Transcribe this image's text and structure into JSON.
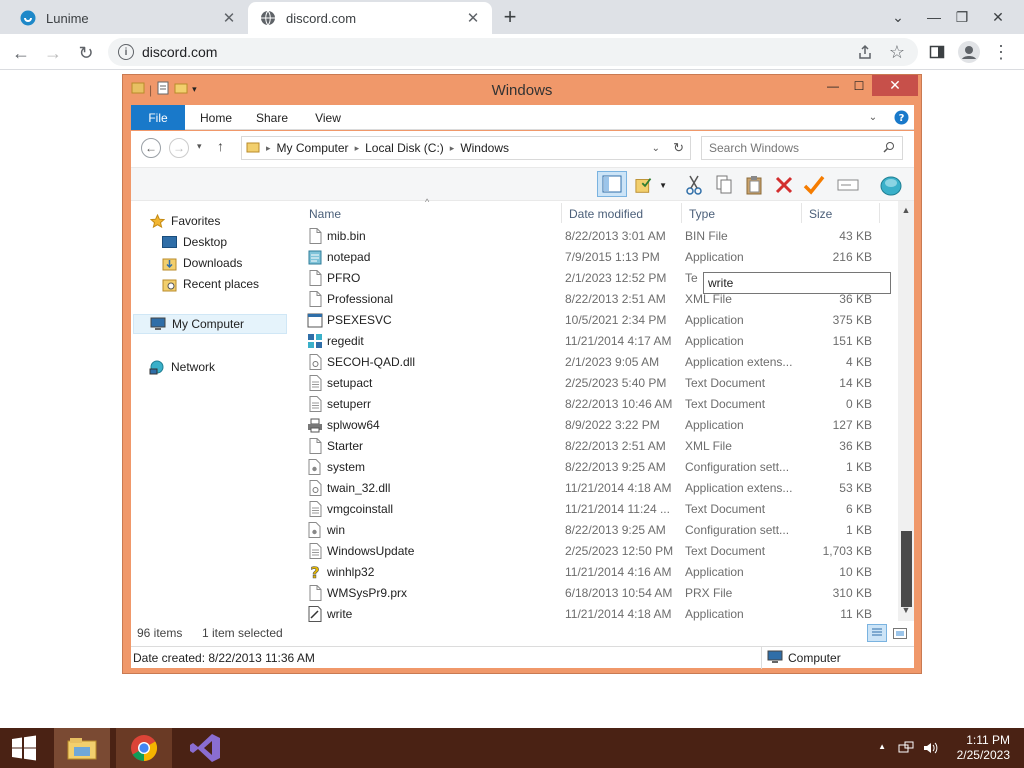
{
  "browser": {
    "tabs": [
      {
        "title": "Lunime",
        "favicon": "lunime-icon"
      },
      {
        "title": "discord.com",
        "favicon": "globe-icon"
      }
    ],
    "url": "discord.com"
  },
  "window": {
    "title": "Windows",
    "accent_color": "#f0986a"
  },
  "ribbon": {
    "tabs": [
      "File",
      "Home",
      "Share",
      "View"
    ]
  },
  "address": {
    "crumbs": [
      "My Computer",
      "Local Disk (C:)",
      "Windows"
    ],
    "search_placeholder": "Search Windows"
  },
  "nav": {
    "favorites": "Favorites",
    "desktop": "Desktop",
    "downloads": "Downloads",
    "recent": "Recent places",
    "computer": "My Computer",
    "network": "Network"
  },
  "columns": {
    "name": "Name",
    "date": "Date modified",
    "type": "Type",
    "size": "Size"
  },
  "files": [
    {
      "name": "mib.bin",
      "date": "8/22/2013 3:01 AM",
      "type": "BIN File",
      "size": "43 KB",
      "icon": "file-icon"
    },
    {
      "name": "notepad",
      "date": "7/9/2015 1:13 PM",
      "type": "Application",
      "size": "216 KB",
      "icon": "notepad-icon"
    },
    {
      "name": "PFRO",
      "date": "2/1/2023 12:52 PM",
      "type": "Te",
      "size": "",
      "icon": "file-icon"
    },
    {
      "name": "Professional",
      "date": "8/22/2013 2:51 AM",
      "type": "XML File",
      "size": "36 KB",
      "icon": "file-icon"
    },
    {
      "name": "PSEXESVC",
      "date": "10/5/2021 2:34 PM",
      "type": "Application",
      "size": "375 KB",
      "icon": "app-window-icon"
    },
    {
      "name": "regedit",
      "date": "11/21/2014 4:17 AM",
      "type": "Application",
      "size": "151 KB",
      "icon": "regedit-icon"
    },
    {
      "name": "SECOH-QAD.dll",
      "date": "2/1/2023 9:05 AM",
      "type": "Application extens...",
      "size": "4 KB",
      "icon": "dll-icon"
    },
    {
      "name": "setupact",
      "date": "2/25/2023 5:40 PM",
      "type": "Text Document",
      "size": "14 KB",
      "icon": "text-file-icon"
    },
    {
      "name": "setuperr",
      "date": "8/22/2013 10:46 AM",
      "type": "Text Document",
      "size": "0 KB",
      "icon": "text-file-icon"
    },
    {
      "name": "splwow64",
      "date": "8/9/2022 3:22 PM",
      "type": "Application",
      "size": "127 KB",
      "icon": "printer-icon"
    },
    {
      "name": "Starter",
      "date": "8/22/2013 2:51 AM",
      "type": "XML File",
      "size": "36 KB",
      "icon": "file-icon"
    },
    {
      "name": "system",
      "date": "8/22/2013 9:25 AM",
      "type": "Configuration sett...",
      "size": "1 KB",
      "icon": "settings-file-icon"
    },
    {
      "name": "twain_32.dll",
      "date": "11/21/2014 4:18 AM",
      "type": "Application extens...",
      "size": "53 KB",
      "icon": "dll-icon"
    },
    {
      "name": "vmgcoinstall",
      "date": "11/21/2014 11:24 ...",
      "type": "Text Document",
      "size": "6 KB",
      "icon": "text-file-icon"
    },
    {
      "name": "win",
      "date": "8/22/2013 9:25 AM",
      "type": "Configuration sett...",
      "size": "1 KB",
      "icon": "settings-file-icon"
    },
    {
      "name": "WindowsUpdate",
      "date": "2/25/2023 12:50 PM",
      "type": "Text Document",
      "size": "1,703 KB",
      "icon": "text-file-icon"
    },
    {
      "name": "winhlp32",
      "date": "11/21/2014 4:16 AM",
      "type": "Application",
      "size": "10 KB",
      "icon": "help-icon"
    },
    {
      "name": "WMSysPr9.prx",
      "date": "6/18/2013 10:54 AM",
      "type": "PRX File",
      "size": "310 KB",
      "icon": "file-icon"
    },
    {
      "name": "write",
      "date": "11/21/2014 4:18 AM",
      "type": "Application",
      "size": "11 KB",
      "icon": "write-icon"
    }
  ],
  "tooltip": "write",
  "status": {
    "count": "96 items",
    "selected": "1 item selected",
    "detail": "Date created: 8/22/2013 11:36 AM",
    "location": "Computer"
  },
  "taskbar": {
    "time": "1:11 PM",
    "date": "2/25/2023",
    "color": "#4a2214"
  }
}
